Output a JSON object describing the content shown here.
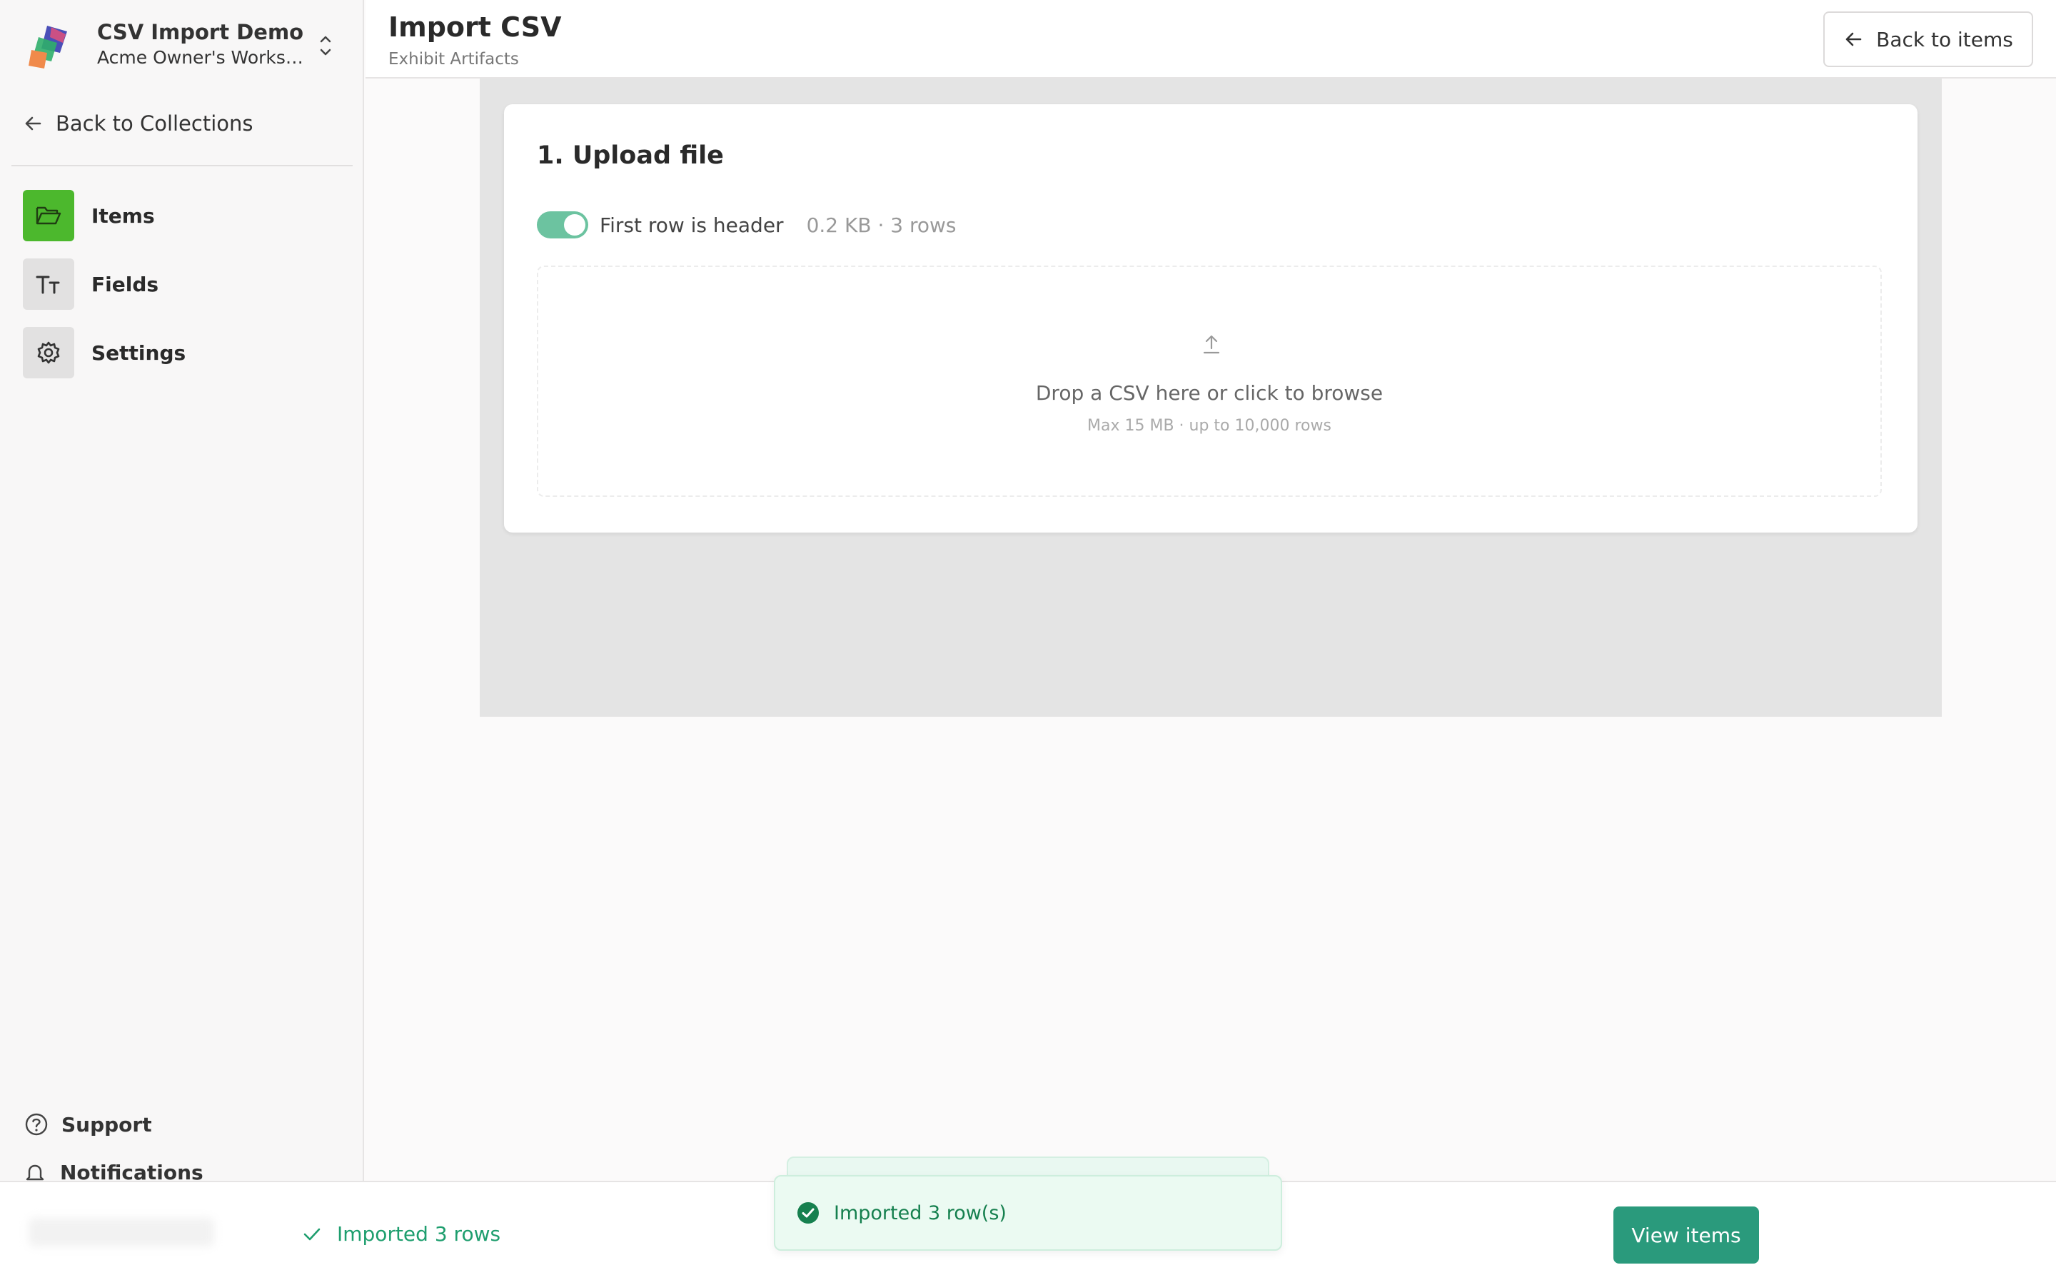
{
  "workspace": {
    "title": "CSV Import Demo",
    "subtitle": "Acme Owner's Workspa..."
  },
  "sidebar": {
    "back_label": "Back to Collections",
    "items": [
      {
        "label": "Items",
        "icon": "folder-open-icon",
        "active": true
      },
      {
        "label": "Fields",
        "icon": "text-type-icon",
        "active": false
      },
      {
        "label": "Settings",
        "icon": "gear-icon",
        "active": false
      }
    ],
    "support_label": "Support",
    "notifications_label": "Notifications"
  },
  "header": {
    "title": "Import CSV",
    "subtitle": "Exhibit Artifacts",
    "back_button": "Back to items"
  },
  "upload": {
    "title": "1. Upload file",
    "header_toggle_label": "First row is header",
    "header_toggle_on": true,
    "file_meta": "0.2 KB · 3 rows",
    "dropzone_text": "Drop a CSV here or click to browse",
    "dropzone_hint": "Max 15 MB · up to 10,000 rows"
  },
  "footer": {
    "status": "Imported 3 rows",
    "primary_button": "View items"
  },
  "toast": {
    "message": "Imported 3 row(s)"
  },
  "colors": {
    "accent_green": "#4cb82d",
    "primary_button": "#2a9a7c",
    "success_text": "#16804f",
    "toggle_on": "#6cc3a0"
  }
}
